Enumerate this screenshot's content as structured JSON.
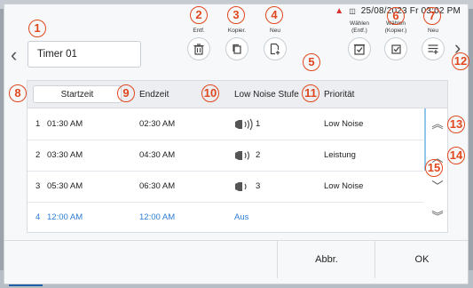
{
  "status": {
    "date_time": "25/08/2023 Fr 03:02 PM"
  },
  "timer": {
    "name": "Timer 01"
  },
  "toolbar": [
    {
      "label": "Entf.",
      "icon": "trash-icon",
      "marker": "2"
    },
    {
      "label": "Kopier.",
      "icon": "copy-icon",
      "marker": "3"
    },
    {
      "label": "Neu",
      "icon": "add-page-icon",
      "marker": "4"
    },
    {
      "label": "Wählen (Entf.)",
      "icon": "select-delete-icon",
      "marker": ""
    },
    {
      "label": "Wählen (Kopier.)",
      "icon": "select-copy-icon",
      "marker": "6"
    },
    {
      "label": "Neu",
      "icon": "add-list-icon",
      "marker": "7"
    }
  ],
  "table": {
    "headers": {
      "start": "Startzeit",
      "end": "Endzeit",
      "noise": "Low Noise Stufe",
      "priority": "Priorität"
    },
    "rows": [
      {
        "index": "1",
        "start": "01:30 AM",
        "end": "02:30 AM",
        "level": "1",
        "priority": "Low Noise"
      },
      {
        "index": "2",
        "start": "03:30 AM",
        "end": "04:30 AM",
        "level": "2",
        "priority": "Leistung"
      },
      {
        "index": "3",
        "start": "05:30 AM",
        "end": "06:30 AM",
        "level": "3",
        "priority": "Low Noise"
      },
      {
        "index": "4",
        "start": "12:00 AM",
        "end": "12:00 AM",
        "level": "Aus",
        "priority": ""
      }
    ]
  },
  "footer": {
    "cancel": "Abbr.",
    "ok": "OK"
  },
  "markers": [
    "1",
    "2",
    "3",
    "4",
    "5",
    "6",
    "7",
    "8",
    "9",
    "10",
    "11",
    "12",
    "13",
    "14",
    "15"
  ],
  "colors": {
    "marker": "#e0471e",
    "accent": "#2e7bd6"
  }
}
